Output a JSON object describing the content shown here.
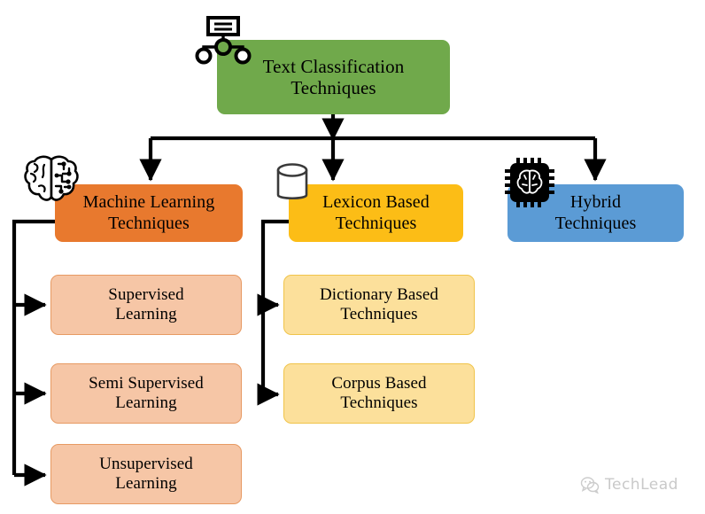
{
  "diagram": {
    "title": "Text Classification Techniques",
    "type": "hierarchy-tree",
    "background_color": "#FFFFFF"
  },
  "root": {
    "label": "Text Classification\nTechniques",
    "color": "#70A94B",
    "icon": "hierarchy-icon"
  },
  "branches": [
    {
      "id": "machine-learning",
      "label": "Machine Learning\nTechniques",
      "color": "#E8792E",
      "icon": "brain-circuit-icon",
      "children": [
        {
          "id": "supervised",
          "label": "Supervised\nLearning",
          "color": "#F6C6A6"
        },
        {
          "id": "semi-supervised",
          "label": "Semi Supervised\nLearning",
          "color": "#F6C6A6"
        },
        {
          "id": "unsupervised",
          "label": "Unsupervised\nLearning",
          "color": "#F6C6A6"
        }
      ]
    },
    {
      "id": "lexicon-based",
      "label": "Lexicon Based\nTechniques",
      "color": "#FCBD16",
      "icon": "database-icon",
      "children": [
        {
          "id": "dictionary-based",
          "label": "Dictionary Based\nTechniques",
          "color": "#FCE09B"
        },
        {
          "id": "corpus-based",
          "label": "Corpus Based\nTechniques",
          "color": "#FCE09B"
        }
      ]
    },
    {
      "id": "hybrid",
      "label": "Hybrid\nTechniques",
      "color": "#5B9BD5",
      "icon": "ai-chip-icon",
      "children": []
    }
  ],
  "connector": {
    "color": "#000000",
    "style": "elbow-arrow"
  },
  "watermark": {
    "text": "TechLead",
    "logo_icon": "wechat-logo-icon",
    "color": "#C9C9C9"
  }
}
